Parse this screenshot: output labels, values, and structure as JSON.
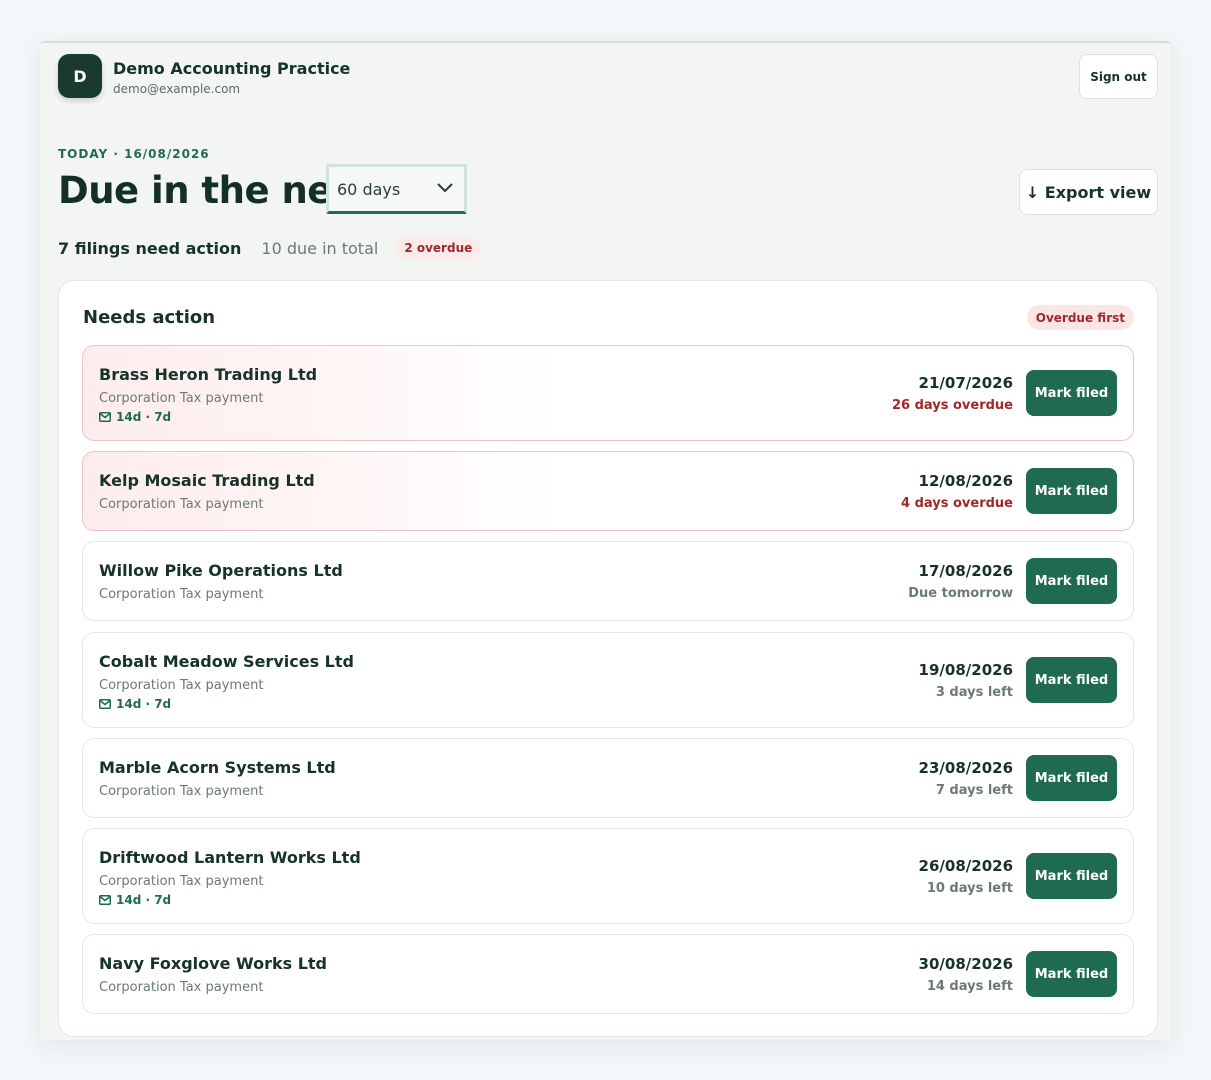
{
  "header": {
    "avatar_letter": "D",
    "org_name": "Demo Accounting Practice",
    "org_email": "demo@example.com",
    "sign_out_label": "Sign out"
  },
  "overview": {
    "today_label": "TODAY · 16/08/2026",
    "heading": "Due in the next",
    "range_selected": "60 days",
    "export_label": "↓ Export view"
  },
  "summary": {
    "need_action": "7 filings need action",
    "total": "10 due in total",
    "overdue_badge": "2 overdue"
  },
  "card": {
    "title": "Needs action",
    "sort_badge": "Overdue first",
    "mark_filed_label": "Mark filed",
    "rows": [
      {
        "client": "Brass Heron Trading Ltd",
        "filing": "Corporation Tax payment",
        "reminder": "14d · 7d",
        "date": "21/07/2026",
        "status": "26 days overdue",
        "overdue": true
      },
      {
        "client": "Kelp Mosaic Trading Ltd",
        "filing": "Corporation Tax payment",
        "reminder": "",
        "date": "12/08/2026",
        "status": "4 days overdue",
        "overdue": true
      },
      {
        "client": "Willow Pike Operations Ltd",
        "filing": "Corporation Tax payment",
        "reminder": "",
        "date": "17/08/2026",
        "status": "Due tomorrow",
        "overdue": false
      },
      {
        "client": "Cobalt Meadow Services Ltd",
        "filing": "Corporation Tax payment",
        "reminder": "14d · 7d",
        "date": "19/08/2026",
        "status": "3 days left",
        "overdue": false
      },
      {
        "client": "Marble Acorn Systems Ltd",
        "filing": "Corporation Tax payment",
        "reminder": "",
        "date": "23/08/2026",
        "status": "7 days left",
        "overdue": false
      },
      {
        "client": "Driftwood Lantern Works Ltd",
        "filing": "Corporation Tax payment",
        "reminder": "14d · 7d",
        "date": "26/08/2026",
        "status": "10 days left",
        "overdue": false
      },
      {
        "client": "Navy Foxglove Works Ltd",
        "filing": "Corporation Tax payment",
        "reminder": "",
        "date": "30/08/2026",
        "status": "14 days left",
        "overdue": false
      }
    ]
  },
  "colors": {
    "brand_green": "#1e6b51",
    "overdue_red": "#a3262b",
    "avatar_bg": "#1a3a2e"
  },
  "icons": {
    "reminder": "mail-icon",
    "dropdown": "chevron-down-icon"
  }
}
